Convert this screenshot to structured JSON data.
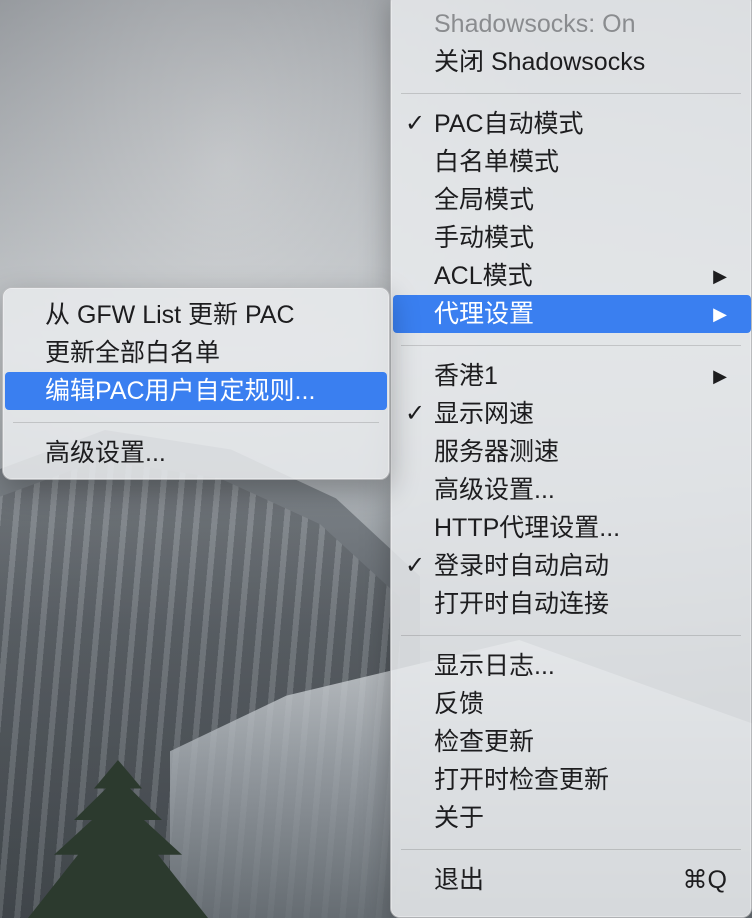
{
  "main_menu": {
    "status": "Shadowsocks: On",
    "toggle": "关闭 Shadowsocks",
    "modes": [
      {
        "label": "PAC自动模式",
        "checked": true,
        "submenu": false
      },
      {
        "label": "白名单模式",
        "checked": false,
        "submenu": false
      },
      {
        "label": "全局模式",
        "checked": false,
        "submenu": false
      },
      {
        "label": "手动模式",
        "checked": false,
        "submenu": false
      },
      {
        "label": "ACL模式",
        "checked": false,
        "submenu": true
      },
      {
        "label": "代理设置",
        "checked": false,
        "submenu": true,
        "selected": true
      }
    ],
    "server": "香港1",
    "options": [
      {
        "label": "显示网速",
        "checked": true
      },
      {
        "label": "服务器测速",
        "checked": false
      },
      {
        "label": "高级设置...",
        "checked": false
      },
      {
        "label": "HTTP代理设置...",
        "checked": false
      },
      {
        "label": "登录时自动启动",
        "checked": true
      },
      {
        "label": "打开时自动连接",
        "checked": false
      }
    ],
    "misc": [
      {
        "label": "显示日志..."
      },
      {
        "label": "反馈"
      },
      {
        "label": "检查更新"
      },
      {
        "label": "打开时检查更新"
      },
      {
        "label": "关于"
      }
    ],
    "quit": {
      "label": "退出",
      "shortcut": "⌘Q"
    },
    "checkmark": "✓",
    "arrow": "▶"
  },
  "sub_menu": {
    "items": [
      {
        "label": "从 GFW List 更新 PAC"
      },
      {
        "label": "更新全部白名单"
      },
      {
        "label": "编辑PAC用户自定规则...",
        "selected": true
      }
    ],
    "advanced": "高级设置..."
  },
  "colors": {
    "selection": "#3a7ff0",
    "menu_bg": "#e8eaec",
    "text": "#1d1d1f",
    "disabled_text": "#8a8c8f"
  }
}
